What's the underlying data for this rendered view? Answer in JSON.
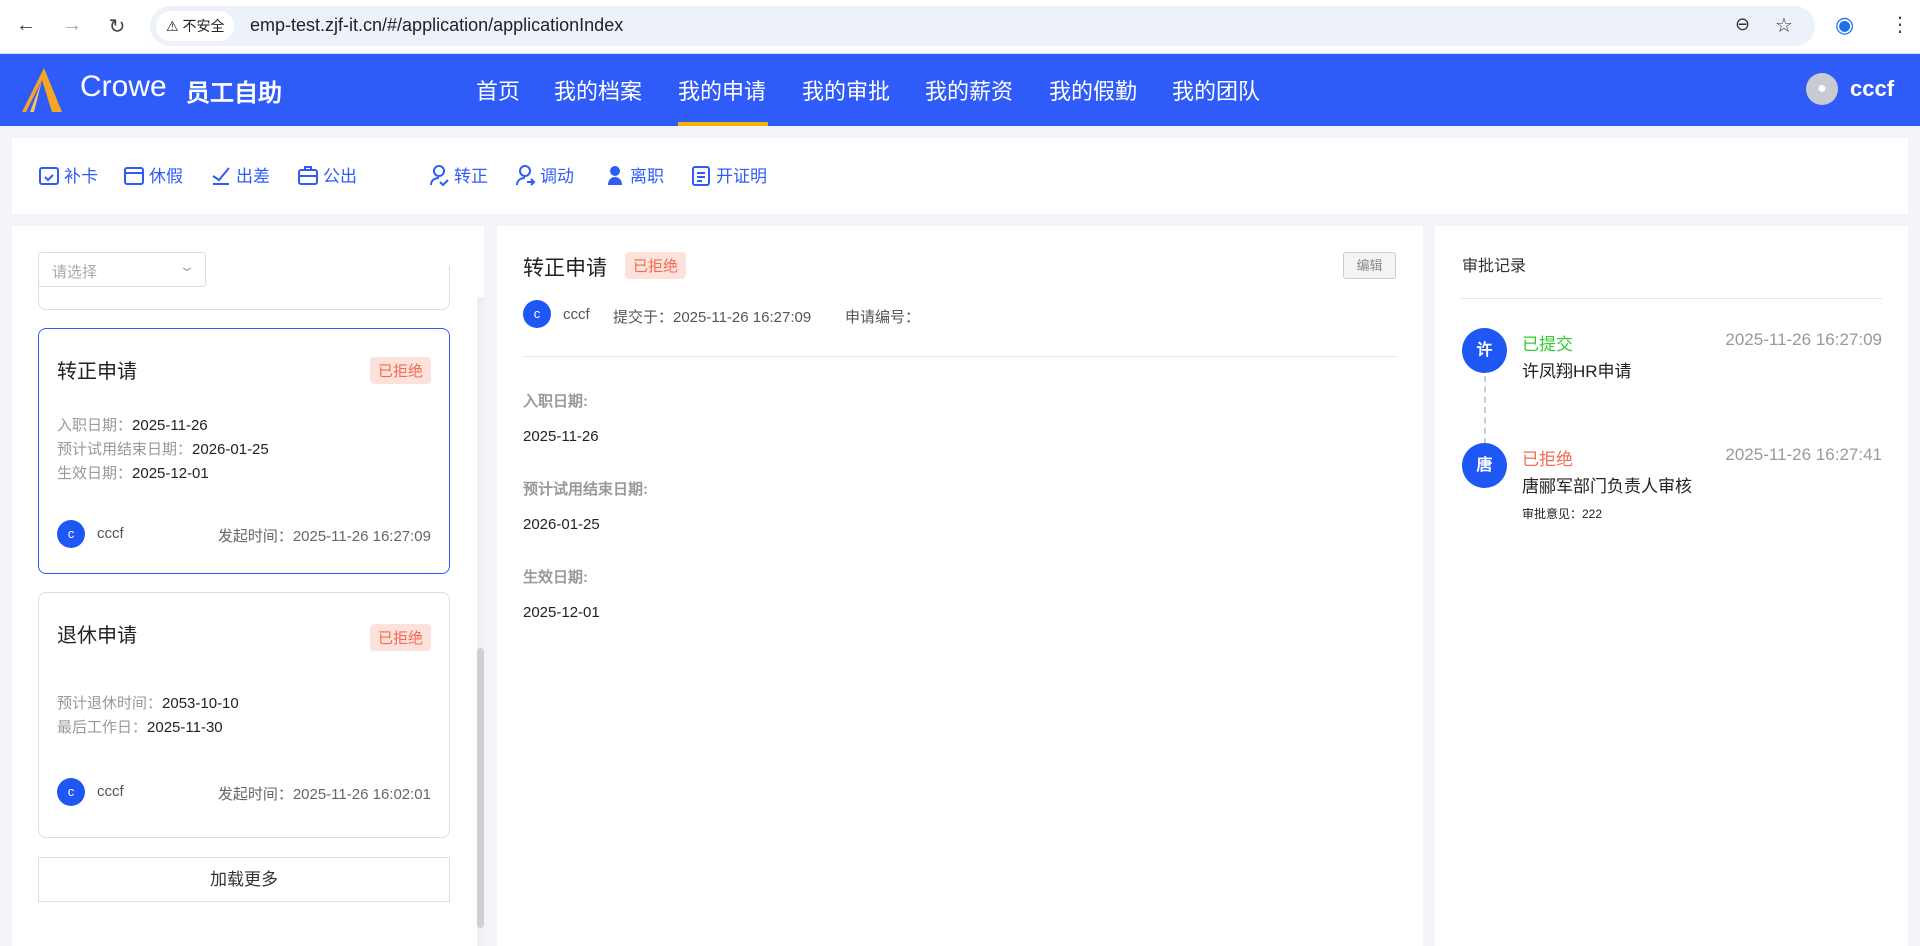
{
  "browser": {
    "security": "不安全",
    "url": "emp-test.zjf-it.cn/#/application/applicationIndex"
  },
  "header": {
    "brand": "Crowe",
    "product": "员工自助",
    "nav": [
      "首页",
      "我的档案",
      "我的申请",
      "我的审批",
      "我的薪资",
      "我的假勤",
      "我的团队"
    ],
    "active_nav": "我的申请",
    "user": "cccf"
  },
  "toolbar": {
    "items": [
      "补卡",
      "休假",
      "出差",
      "公出",
      "转正",
      "调动",
      "离职",
      "开证明"
    ]
  },
  "list": {
    "filter_placeholder": "请选择",
    "load_more": "加载更多",
    "cards": [
      {
        "title": "转正申请",
        "status": "已拒绝",
        "fields": [
          {
            "label": "入职日期：",
            "value": "2025-11-26"
          },
          {
            "label": "预计试用结束日期：",
            "value": "2026-01-25"
          },
          {
            "label": "生效日期：",
            "value": "2025-12-01"
          }
        ],
        "avatar": "c",
        "user": "cccf",
        "time": "发起时间：2025-11-26 16:27:09"
      },
      {
        "title": "退休申请",
        "status": "已拒绝",
        "fields": [
          {
            "label": "预计退休时间：",
            "value": "2053-10-10"
          },
          {
            "label": "最后工作日：",
            "value": "2025-11-30"
          }
        ],
        "avatar": "c",
        "user": "cccf",
        "time": "发起时间：2025-11-26 16:02:01"
      }
    ]
  },
  "detail": {
    "title": "转正申请",
    "status": "已拒绝",
    "edit": "编辑",
    "avatar": "c",
    "user": "cccf",
    "submitted": "提交于：2025-11-26 16:27:09",
    "number_label": "申请编号：",
    "fields": [
      {
        "label": "入职日期:",
        "value": "2025-11-26"
      },
      {
        "label": "预计试用结束日期:",
        "value": "2026-01-25"
      },
      {
        "label": "生效日期:",
        "value": "2025-12-01"
      }
    ]
  },
  "approval": {
    "title": "审批记录",
    "records": [
      {
        "avatar": "许",
        "status": "已提交",
        "status_color": "#33cc33",
        "time": "2025-11-26 16:27:09",
        "desc": "许凤翔HR申请"
      },
      {
        "avatar": "唐",
        "status": "已拒绝",
        "status_color": "#f56c4c",
        "time": "2025-11-26 16:27:41",
        "desc": "唐郦军部门负责人审核",
        "comment": "审批意见：222"
      }
    ]
  }
}
